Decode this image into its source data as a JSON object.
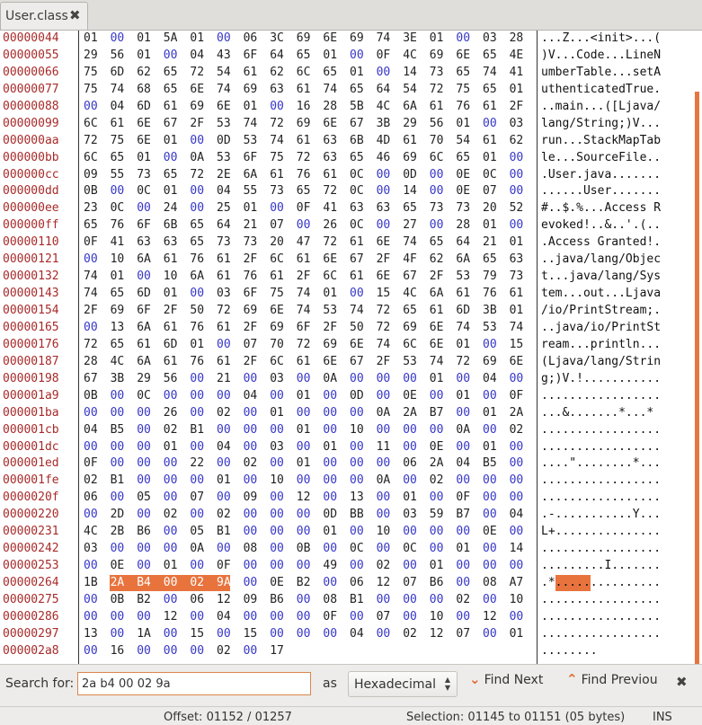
{
  "tab": {
    "title": "User.class"
  },
  "colors": {
    "highlight": "#e8733d",
    "offset": "#a82a2a",
    "zero_byte": "#3636c6"
  },
  "rows": [
    {
      "offset": "00000044",
      "hex": "01 00 01 5A 01 00 06 3C 69 6E 69 74 3E 01 00 03 28",
      "ascii": "...Z...<init>...("
    },
    {
      "offset": "00000055",
      "hex": "29 56 01 00 04 43 6F 64 65 01 00 0F 4C 69 6E 65 4E",
      "ascii": ")V...Code...LineN"
    },
    {
      "offset": "00000066",
      "hex": "75 6D 62 65 72 54 61 62 6C 65 01 00 14 73 65 74 41",
      "ascii": "umberTable...setA"
    },
    {
      "offset": "00000077",
      "hex": "75 74 68 65 6E 74 69 63 61 74 65 64 54 72 75 65 01",
      "ascii": "uthenticatedTrue."
    },
    {
      "offset": "00000088",
      "hex": "00 04 6D 61 69 6E 01 00 16 28 5B 4C 6A 61 76 61 2F",
      "ascii": "..main...([Ljava/"
    },
    {
      "offset": "00000099",
      "hex": "6C 61 6E 67 2F 53 74 72 69 6E 67 3B 29 56 01 00 03",
      "ascii": "lang/String;)V..."
    },
    {
      "offset": "000000aa",
      "hex": "72 75 6E 01 00 0D 53 74 61 63 6B 4D 61 70 54 61 62",
      "ascii": "run...StackMapTab"
    },
    {
      "offset": "000000bb",
      "hex": "6C 65 01 00 0A 53 6F 75 72 63 65 46 69 6C 65 01 00",
      "ascii": "le...SourceFile.."
    },
    {
      "offset": "000000cc",
      "hex": "09 55 73 65 72 2E 6A 61 76 61 0C 00 0D 00 0E 0C 00",
      "ascii": ".User.java......."
    },
    {
      "offset": "000000dd",
      "hex": "0B 00 0C 01 00 04 55 73 65 72 0C 00 14 00 0E 07 00",
      "ascii": "......User......."
    },
    {
      "offset": "000000ee",
      "hex": "23 0C 00 24 00 25 01 00 0F 41 63 63 65 73 73 20 52",
      "ascii": "#..$.%...Access R"
    },
    {
      "offset": "000000ff",
      "hex": "65 76 6F 6B 65 64 21 07 00 26 0C 00 27 00 28 01 00",
      "ascii": "evoked!..&..'.(.."
    },
    {
      "offset": "00000110",
      "hex": "0F 41 63 63 65 73 73 20 47 72 61 6E 74 65 64 21 01",
      "ascii": ".Access Granted!."
    },
    {
      "offset": "00000121",
      "hex": "00 10 6A 61 76 61 2F 6C 61 6E 67 2F 4F 62 6A 65 63",
      "ascii": "..java/lang/Objec"
    },
    {
      "offset": "00000132",
      "hex": "74 01 00 10 6A 61 76 61 2F 6C 61 6E 67 2F 53 79 73",
      "ascii": "t...java/lang/Sys"
    },
    {
      "offset": "00000143",
      "hex": "74 65 6D 01 00 03 6F 75 74 01 00 15 4C 6A 61 76 61",
      "ascii": "tem...out...Ljava"
    },
    {
      "offset": "00000154",
      "hex": "2F 69 6F 2F 50 72 69 6E 74 53 74 72 65 61 6D 3B 01",
      "ascii": "/io/PrintStream;."
    },
    {
      "offset": "00000165",
      "hex": "00 13 6A 61 76 61 2F 69 6F 2F 50 72 69 6E 74 53 74",
      "ascii": "..java/io/PrintSt"
    },
    {
      "offset": "00000176",
      "hex": "72 65 61 6D 01 00 07 70 72 69 6E 74 6C 6E 01 00 15",
      "ascii": "ream...println..."
    },
    {
      "offset": "00000187",
      "hex": "28 4C 6A 61 76 61 2F 6C 61 6E 67 2F 53 74 72 69 6E",
      "ascii": "(Ljava/lang/Strin"
    },
    {
      "offset": "00000198",
      "hex": "67 3B 29 56 00 21 00 03 00 0A 00 00 00 01 00 04 00",
      "ascii": "g;)V.!..........."
    },
    {
      "offset": "000001a9",
      "hex": "0B 00 0C 00 00 00 04 00 01 00 0D 00 0E 00 01 00 0F",
      "ascii": "................."
    },
    {
      "offset": "000001ba",
      "hex": "00 00 00 26 00 02 00 01 00 00 00 0A 2A B7 00 01 2A",
      "ascii": "...&.......*...*"
    },
    {
      "offset": "000001cb",
      "hex": "04 B5 00 02 B1 00 00 00 01 00 10 00 00 00 0A 00 02",
      "ascii": "................."
    },
    {
      "offset": "000001dc",
      "hex": "00 00 00 01 00 04 00 03 00 01 00 11 00 0E 00 01 00",
      "ascii": "................."
    },
    {
      "offset": "000001ed",
      "hex": "0F 00 00 00 22 00 02 00 01 00 00 00 06 2A 04 B5 00",
      "ascii": "....\"........*..."
    },
    {
      "offset": "000001fe",
      "hex": "02 B1 00 00 00 01 00 10 00 00 00 0A 00 02 00 00 00",
      "ascii": "................."
    },
    {
      "offset": "0000020f",
      "hex": "06 00 05 00 07 00 09 00 12 00 13 00 01 00 0F 00 00",
      "ascii": "................."
    },
    {
      "offset": "00000220",
      "hex": "00 2D 00 02 00 02 00 00 00 0D BB 00 03 59 B7 00 04",
      "ascii": ".-...........Y..."
    },
    {
      "offset": "00000231",
      "hex": "4C 2B B6 00 05 B1 00 00 00 01 00 10 00 00 00 0E 00",
      "ascii": "L+..............."
    },
    {
      "offset": "00000242",
      "hex": "03 00 00 00 0A 00 08 00 0B 00 0C 00 0C 00 01 00 14",
      "ascii": "................."
    },
    {
      "offset": "00000253",
      "hex": "00 0E 00 01 00 0F 00 00 00 49 00 02 00 01 00 00 00",
      "ascii": ".........I......."
    },
    {
      "offset": "00000264",
      "hex": "1B 2A B4 00 02 9A 00 0E B2 00 06 12 07 B6 00 08 A7",
      "ascii": ".*..............."
    },
    {
      "offset": "00000275",
      "hex": "00 0B B2 00 06 12 09 B6 00 08 B1 00 00 00 02 00 10",
      "ascii": "................."
    },
    {
      "offset": "00000286",
      "hex": "00 00 00 12 00 04 00 00 00 0F 00 07 00 10 00 12 00",
      "ascii": "................."
    },
    {
      "offset": "00000297",
      "hex": "13 00 1A 00 15 00 15 00 00 00 04 00 02 12 07 00 01",
      "ascii": "................."
    },
    {
      "offset": "000002a8",
      "hex": "00 16 00 00 00 02 00 17",
      "ascii": "........"
    }
  ],
  "selection_row": 32,
  "selection_from": 1,
  "selection_to": 5,
  "search": {
    "label": "Search for:",
    "value": "2a b4 00 02 9a",
    "as_label": "as",
    "format": "Hexadecimal",
    "find_next": "Find Next",
    "find_previous": "Find Previou"
  },
  "status": {
    "offset": "Offset: 01152 / 01257",
    "selection": "Selection: 01145 to 01151 (05 bytes)",
    "mode": "INS"
  }
}
